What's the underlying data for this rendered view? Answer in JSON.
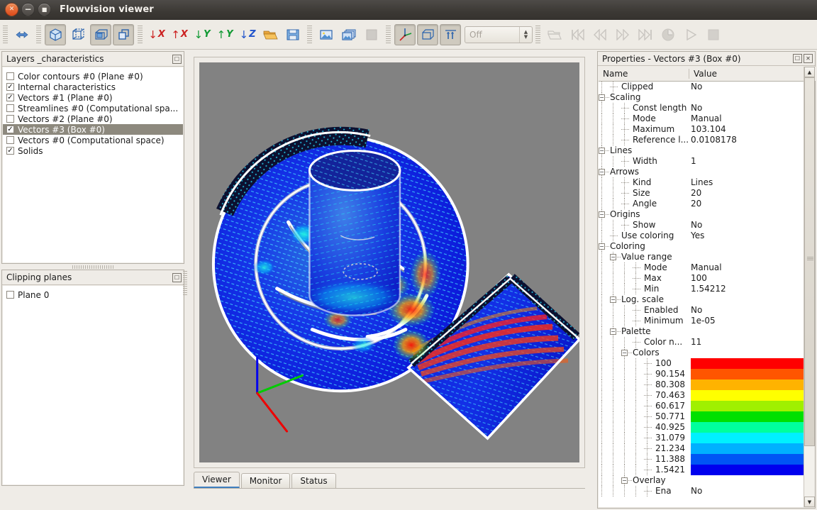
{
  "window": {
    "title": "Flowvision viewer",
    "close_glyph": "✕",
    "min_glyph": "−",
    "max_glyph": "■"
  },
  "toolbar": {
    "groups": [
      {
        "name": "navigation",
        "buttons": [
          {
            "name": "fit-to-window-button",
            "icon": "left-right-arrow-icon",
            "glyph": "⬌",
            "pressed": false,
            "disabled": false
          }
        ]
      },
      {
        "name": "view-mode",
        "buttons": [
          {
            "name": "solid-view-button",
            "icon": "solid-cube-icon",
            "glyph": "cube-solid",
            "pressed": true,
            "disabled": false
          },
          {
            "name": "wireframe-view-button",
            "icon": "wireframe-cube-icon",
            "glyph": "cube-wire",
            "pressed": false,
            "disabled": false
          },
          {
            "name": "shaded-plane-button",
            "icon": "cube-open-icon",
            "glyph": "cube-open",
            "pressed": true,
            "disabled": false
          },
          {
            "name": "copy-view-button",
            "icon": "two-squares-icon",
            "glyph": "squares",
            "pressed": true,
            "disabled": false
          }
        ]
      },
      {
        "name": "axis-views",
        "buttons": [
          {
            "name": "view-minus-x-button",
            "icon": "axis-down-x-icon",
            "arrow": "↓",
            "axis": "X",
            "color": "#cc2222"
          },
          {
            "name": "view-plus-x-button",
            "icon": "axis-up-x-icon",
            "arrow": "↑",
            "axis": "X",
            "color": "#cc2222"
          },
          {
            "name": "view-minus-y-button",
            "icon": "axis-down-y-icon",
            "arrow": "↓",
            "axis": "Y",
            "color": "#119933"
          },
          {
            "name": "view-plus-y-button",
            "icon": "axis-up-y-icon",
            "arrow": "↑",
            "axis": "Y",
            "color": "#119933"
          },
          {
            "name": "view-minus-z-button",
            "icon": "axis-down-z-icon",
            "arrow": "↓",
            "axis": "Z",
            "color": "#2255cc"
          }
        ]
      },
      {
        "name": "file",
        "buttons": [
          {
            "name": "open-scene-button",
            "icon": "open-folder-icon",
            "glyph": "folder"
          },
          {
            "name": "save-image-button",
            "icon": "save-picture-icon",
            "glyph": "save"
          }
        ]
      },
      {
        "name": "capture",
        "buttons": [
          {
            "name": "snapshot-button",
            "icon": "picture-icon",
            "glyph": "picture"
          },
          {
            "name": "sequence-button",
            "icon": "pictures-stack-icon",
            "glyph": "pictures"
          },
          {
            "name": "stop-capture-button",
            "icon": "stop-square-icon",
            "glyph": "square",
            "disabled": true
          }
        ]
      },
      {
        "name": "display-options",
        "buttons": [
          {
            "name": "show-axes-button",
            "icon": "axes-triad-icon",
            "glyph": "triad",
            "pressed": true
          },
          {
            "name": "show-bounding-box-button",
            "icon": "bounding-box-icon",
            "glyph": "cube-open",
            "pressed": true
          },
          {
            "name": "show-legend-button",
            "icon": "legend-bars-icon",
            "glyph": "legend",
            "pressed": true
          }
        ]
      }
    ],
    "animation_combo": {
      "name": "animation-mode-combo",
      "value": "Off"
    },
    "playback": [
      {
        "name": "open-animation-button",
        "icon": "open-folder-icon",
        "glyph": "folder",
        "disabled": true
      },
      {
        "name": "go-to-start-button",
        "icon": "skip-backward-icon",
        "glyph": "⏮",
        "disabled": true
      },
      {
        "name": "step-backward-button",
        "icon": "rewind-icon",
        "glyph": "⏪",
        "disabled": true
      },
      {
        "name": "step-forward-button",
        "icon": "fast-forward-icon",
        "glyph": "⏩",
        "disabled": true
      },
      {
        "name": "go-to-end-button",
        "icon": "skip-forward-icon",
        "glyph": "⏭",
        "disabled": true
      },
      {
        "name": "timer-button",
        "icon": "clock-icon",
        "glyph": "◔",
        "disabled": true
      },
      {
        "name": "play-button",
        "icon": "play-icon",
        "glyph": "▶",
        "disabled": true
      },
      {
        "name": "stop-button",
        "icon": "stop-icon",
        "glyph": "■",
        "disabled": true
      }
    ]
  },
  "layers_panel": {
    "title": "Layers _characteristics",
    "float_icon": "restore-icon",
    "items": [
      {
        "label": "Color contours #0 (Plane #0)",
        "checked": false,
        "selected": false
      },
      {
        "label": "Internal characteristics",
        "checked": true,
        "selected": false
      },
      {
        "label": "Vectors #1 (Plane #0)",
        "checked": true,
        "selected": false
      },
      {
        "label": "Streamlines #0 (Computational spa...",
        "checked": false,
        "selected": false
      },
      {
        "label": "Vectors #2 (Plane #0)",
        "checked": false,
        "selected": false
      },
      {
        "label": "Vectors #3 (Box #0)",
        "checked": true,
        "selected": true
      },
      {
        "label": "Vectors #0 (Computational space)",
        "checked": false,
        "selected": false
      },
      {
        "label": "Solids",
        "checked": true,
        "selected": false
      }
    ]
  },
  "clipping_panel": {
    "title": "Clipping planes",
    "float_icon": "restore-icon",
    "items": [
      {
        "label": "Plane 0",
        "checked": false,
        "selected": false
      }
    ]
  },
  "viewer": {
    "tabs": [
      {
        "label": "Viewer",
        "active": true
      },
      {
        "label": "Monitor",
        "active": false
      },
      {
        "label": "Status",
        "active": false
      }
    ],
    "background_color": "#828282",
    "axes": {
      "x_color": "#ee0000",
      "y_color": "#00cc00",
      "z_color": "#0000ee"
    }
  },
  "properties_panel": {
    "title": "Properties - Vectors #3 (Box #0)",
    "float_icon": "restore-icon",
    "close_icon": "close-icon",
    "columns": {
      "name": "Name",
      "value": "Value"
    },
    "rows": [
      {
        "label": "Clipped",
        "value": "No",
        "depth": 1,
        "node": "leaf"
      },
      {
        "label": "Scaling",
        "value": "",
        "depth": 0,
        "node": "expanded"
      },
      {
        "label": "Const length",
        "value": "No",
        "depth": 2,
        "node": "leaf"
      },
      {
        "label": "Mode",
        "value": "Manual",
        "depth": 2,
        "node": "leaf"
      },
      {
        "label": "Maximum",
        "value": "103.104",
        "depth": 2,
        "node": "leaf"
      },
      {
        "label": "Reference l...",
        "value": "0.0108178",
        "depth": 2,
        "node": "last"
      },
      {
        "label": "Lines",
        "value": "",
        "depth": 0,
        "node": "expanded"
      },
      {
        "label": "Width",
        "value": "1",
        "depth": 2,
        "node": "last"
      },
      {
        "label": "Arrows",
        "value": "",
        "depth": 0,
        "node": "expanded"
      },
      {
        "label": "Kind",
        "value": "Lines",
        "depth": 2,
        "node": "leaf"
      },
      {
        "label": "Size",
        "value": "20",
        "depth": 2,
        "node": "leaf"
      },
      {
        "label": "Angle",
        "value": "20",
        "depth": 2,
        "node": "last"
      },
      {
        "label": "Origins",
        "value": "",
        "depth": 0,
        "node": "expanded"
      },
      {
        "label": "Show",
        "value": "No",
        "depth": 2,
        "node": "last"
      },
      {
        "label": "Use coloring",
        "value": "Yes",
        "depth": 1,
        "node": "leaf"
      },
      {
        "label": "Coloring",
        "value": "",
        "depth": 0,
        "node": "expanded"
      },
      {
        "label": "Value range",
        "value": "",
        "depth": 1,
        "node": "expanded"
      },
      {
        "label": "Mode",
        "value": "Manual",
        "depth": 3,
        "node": "leaf"
      },
      {
        "label": "Max",
        "value": "100",
        "depth": 3,
        "node": "leaf"
      },
      {
        "label": "Min",
        "value": "1.54212",
        "depth": 3,
        "node": "last"
      },
      {
        "label": "Log. scale",
        "value": "",
        "depth": 1,
        "node": "expanded"
      },
      {
        "label": "Enabled",
        "value": "No",
        "depth": 3,
        "node": "leaf"
      },
      {
        "label": "Minimum",
        "value": "1e-05",
        "depth": 3,
        "node": "last"
      },
      {
        "label": "Palette",
        "value": "",
        "depth": 1,
        "node": "expanded"
      },
      {
        "label": "Color n...",
        "value": "11",
        "depth": 3,
        "node": "leaf"
      },
      {
        "label": "Colors",
        "value": "",
        "depth": 2,
        "node": "expanded"
      }
    ],
    "palette": {
      "color_count": "11",
      "entries": [
        {
          "label": "100",
          "color": "#ff0000"
        },
        {
          "label": "90.154",
          "color": "#ff5500"
        },
        {
          "label": "80.308",
          "color": "#ffb300"
        },
        {
          "label": "70.463",
          "color": "#ffff00"
        },
        {
          "label": "60.617",
          "color": "#a0f000"
        },
        {
          "label": "50.771",
          "color": "#00e000"
        },
        {
          "label": "40.925",
          "color": "#00ff9d"
        },
        {
          "label": "31.079",
          "color": "#00f0ff"
        },
        {
          "label": "21.234",
          "color": "#00b0ff"
        },
        {
          "label": "11.388",
          "color": "#0055f5"
        },
        {
          "label": "1.5421",
          "color": "#0000ee"
        }
      ]
    },
    "trailing_rows": [
      {
        "label": "Overlay",
        "value": "",
        "depth": 2,
        "node": "expanded"
      },
      {
        "label": "Ena",
        "value": "No",
        "depth": 4,
        "node": "leaf"
      }
    ],
    "scrollbar": {
      "up_glyph": "▲",
      "down_glyph": "▼"
    }
  }
}
